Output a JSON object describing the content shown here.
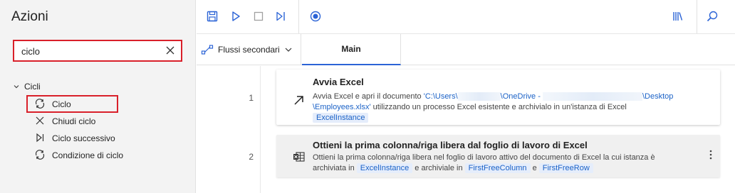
{
  "left_panel": {
    "title": "Azioni",
    "search": {
      "value": "ciclo",
      "placeholder": ""
    },
    "group": {
      "label": "Cicli"
    },
    "items": [
      {
        "label": "Ciclo",
        "icon": "loop-icon"
      },
      {
        "label": "Chiudi ciclo",
        "icon": "close-icon"
      },
      {
        "label": "Ciclo successivo",
        "icon": "next-icon"
      },
      {
        "label": "Condizione di ciclo",
        "icon": "loop-condition-icon"
      }
    ]
  },
  "toolbar": {
    "icons": [
      "save-icon",
      "run-icon",
      "stop-icon",
      "step-icon",
      "record-icon",
      "library-icon",
      "search-icon"
    ]
  },
  "tabs": {
    "subflows_label": "Flussi secondari",
    "main_label": "Main"
  },
  "steps": [
    {
      "number": "1",
      "title": "Avvia Excel",
      "desc_prefix": "Avvia Excel e apri il documento ",
      "path_part1": "'C:\\Users\\",
      "path_part2": "\\OneDrive - ",
      "path_part3": "\\Desktop",
      "path_part4": "\\Employees.xlsx'",
      "desc_suffix": " utilizzando un processo Excel esistente e archivialo in un'istanza di Excel",
      "variable": "ExcelInstance"
    },
    {
      "number": "2",
      "title": "Ottieni la prima colonna/riga libera dal foglio di lavoro di Excel",
      "desc_line1": "Ottieni la prima colonna/riga libera nel foglio di lavoro attivo del documento di Excel la cui istanza è",
      "desc_prefix2": "archiviata in ",
      "variable_in": "ExcelInstance",
      "desc_mid": " e archiviale in ",
      "variable_col": "FirstFreeColumn",
      "desc_and": " e ",
      "variable_row": "FirstFreeRow"
    }
  ],
  "colors": {
    "accent": "#2b63d6",
    "highlight": "#d9202a",
    "link": "#1b62c7"
  }
}
